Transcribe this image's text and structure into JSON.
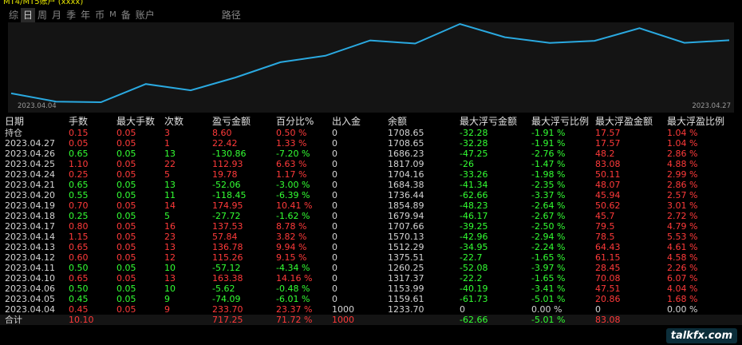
{
  "title_partial": "MT4/MT5账户 (xxxx)",
  "period_tabs": [
    {
      "label": "综",
      "selected": false
    },
    {
      "label": "日",
      "selected": true
    },
    {
      "label": "周",
      "selected": false
    },
    {
      "label": "月",
      "selected": false
    },
    {
      "label": "季",
      "selected": false
    },
    {
      "label": "年",
      "selected": false
    },
    {
      "label": "币",
      "selected": false
    },
    {
      "label": "M",
      "selected": false
    },
    {
      "label": "备",
      "selected": false
    },
    {
      "label": "账户",
      "selected": false
    }
  ],
  "path_label": "路径",
  "chart": {
    "line_color": "#2aa9e0",
    "date_start": "2023.04.04",
    "date_end": "2023.04.27",
    "equity": [
      1233.7,
      1159.61,
      1153.99,
      1317.37,
      1260.25,
      1375.51,
      1512.29,
      1570.13,
      1707.66,
      1679.94,
      1854.89,
      1736.44,
      1684.38,
      1704.16,
      1817.09,
      1686.23,
      1708.65
    ]
  },
  "columns": [
    "日期",
    "手数",
    "最大手数",
    "次数",
    "盈亏金额",
    "百分比%",
    "出入金",
    "余额",
    "最大浮亏金额",
    "最大浮亏比例",
    "最大浮盈金额",
    "最大浮盈比例"
  ],
  "rows": [
    {
      "date": "持仓",
      "lots": "0.15",
      "maxlots": "0.05",
      "count": "3",
      "pl": "8.60",
      "pct": "0.50 %",
      "io": "0",
      "bal": "1708.65",
      "fl": "-32.28",
      "flp": "-1.91 %",
      "fp": "17.57",
      "fpp": "1.04 %",
      "s": "r"
    },
    {
      "date": "2023.04.27",
      "lots": "0.05",
      "maxlots": "0.05",
      "count": "1",
      "pl": "22.42",
      "pct": "1.33 %",
      "io": "0",
      "bal": "1708.65",
      "fl": "-32.28",
      "flp": "-1.91 %",
      "fp": "17.57",
      "fpp": "1.04 %",
      "s": "r"
    },
    {
      "date": "2023.04.26",
      "lots": "0.65",
      "maxlots": "0.05",
      "count": "13",
      "pl": "-130.86",
      "pct": "-7.20 %",
      "io": "0",
      "bal": "1686.23",
      "fl": "-47.25",
      "flp": "-2.76 %",
      "fp": "48.2",
      "fpp": "2.86 %",
      "s": "g"
    },
    {
      "date": "2023.04.25",
      "lots": "1.10",
      "maxlots": "0.05",
      "count": "22",
      "pl": "112.93",
      "pct": "6.63 %",
      "io": "0",
      "bal": "1817.09",
      "fl": "-26",
      "flp": "-1.47 %",
      "fp": "83.08",
      "fpp": "4.88 %",
      "s": "r"
    },
    {
      "date": "2023.04.24",
      "lots": "0.25",
      "maxlots": "0.05",
      "count": "5",
      "pl": "19.78",
      "pct": "1.17 %",
      "io": "0",
      "bal": "1704.16",
      "fl": "-33.26",
      "flp": "-1.98 %",
      "fp": "50.11",
      "fpp": "2.99 %",
      "s": "r"
    },
    {
      "date": "2023.04.21",
      "lots": "0.65",
      "maxlots": "0.05",
      "count": "13",
      "pl": "-52.06",
      "pct": "-3.00 %",
      "io": "0",
      "bal": "1684.38",
      "fl": "-41.34",
      "flp": "-2.35 %",
      "fp": "48.07",
      "fpp": "2.86 %",
      "s": "g"
    },
    {
      "date": "2023.04.20",
      "lots": "0.55",
      "maxlots": "0.05",
      "count": "11",
      "pl": "-118.45",
      "pct": "-6.39 %",
      "io": "0",
      "bal": "1736.44",
      "fl": "-62.66",
      "flp": "-3.37 %",
      "fp": "45.94",
      "fpp": "2.57 %",
      "s": "g"
    },
    {
      "date": "2023.04.19",
      "lots": "0.70",
      "maxlots": "0.05",
      "count": "14",
      "pl": "174.95",
      "pct": "10.41 %",
      "io": "0",
      "bal": "1854.89",
      "fl": "-48.23",
      "flp": "-2.64 %",
      "fp": "50.62",
      "fpp": "3.01 %",
      "s": "r"
    },
    {
      "date": "2023.04.18",
      "lots": "0.25",
      "maxlots": "0.05",
      "count": "5",
      "pl": "-27.72",
      "pct": "-1.62 %",
      "io": "0",
      "bal": "1679.94",
      "fl": "-46.17",
      "flp": "-2.67 %",
      "fp": "45.7",
      "fpp": "2.72 %",
      "s": "g"
    },
    {
      "date": "2023.04.17",
      "lots": "0.80",
      "maxlots": "0.05",
      "count": "16",
      "pl": "137.53",
      "pct": "8.78 %",
      "io": "0",
      "bal": "1707.66",
      "fl": "-39.25",
      "flp": "-2.50 %",
      "fp": "79.5",
      "fpp": "4.79 %",
      "s": "r"
    },
    {
      "date": "2023.04.14",
      "lots": "1.15",
      "maxlots": "0.05",
      "count": "23",
      "pl": "57.84",
      "pct": "3.82 %",
      "io": "0",
      "bal": "1570.13",
      "fl": "-42.96",
      "flp": "-2.94 %",
      "fp": "78.5",
      "fpp": "5.53 %",
      "s": "r"
    },
    {
      "date": "2023.04.13",
      "lots": "0.65",
      "maxlots": "0.05",
      "count": "13",
      "pl": "136.78",
      "pct": "9.94 %",
      "io": "0",
      "bal": "1512.29",
      "fl": "-34.95",
      "flp": "-2.24 %",
      "fp": "64.43",
      "fpp": "4.61 %",
      "s": "r"
    },
    {
      "date": "2023.04.12",
      "lots": "0.60",
      "maxlots": "0.05",
      "count": "12",
      "pl": "115.26",
      "pct": "9.15 %",
      "io": "0",
      "bal": "1375.51",
      "fl": "-22.7",
      "flp": "-1.65 %",
      "fp": "61.15",
      "fpp": "4.58 %",
      "s": "r"
    },
    {
      "date": "2023.04.11",
      "lots": "0.50",
      "maxlots": "0.05",
      "count": "10",
      "pl": "-57.12",
      "pct": "-4.34 %",
      "io": "0",
      "bal": "1260.25",
      "fl": "-52.08",
      "flp": "-3.97 %",
      "fp": "28.45",
      "fpp": "2.26 %",
      "s": "g"
    },
    {
      "date": "2023.04.10",
      "lots": "0.65",
      "maxlots": "0.05",
      "count": "13",
      "pl": "163.38",
      "pct": "14.16 %",
      "io": "0",
      "bal": "1317.37",
      "fl": "-22.2",
      "flp": "-1.65 %",
      "fp": "70.08",
      "fpp": "6.07 %",
      "s": "r"
    },
    {
      "date": "2023.04.06",
      "lots": "0.50",
      "maxlots": "0.05",
      "count": "10",
      "pl": "-5.62",
      "pct": "-0.48 %",
      "io": "0",
      "bal": "1153.99",
      "fl": "-40.19",
      "flp": "-3.41 %",
      "fp": "47.51",
      "fpp": "4.04 %",
      "s": "g"
    },
    {
      "date": "2023.04.05",
      "lots": "0.45",
      "maxlots": "0.05",
      "count": "9",
      "pl": "-74.09",
      "pct": "-6.01 %",
      "io": "0",
      "bal": "1159.61",
      "fl": "-61.73",
      "flp": "-5.01 %",
      "fp": "20.86",
      "fpp": "1.68 %",
      "s": "g"
    },
    {
      "date": "2023.04.04",
      "lots": "0.45",
      "maxlots": "0.05",
      "count": "9",
      "pl": "233.70",
      "pct": "23.37 %",
      "io": "1000",
      "bal": "1233.70",
      "fl": "0",
      "flp": "0.00 %",
      "fp": "0",
      "fpp": "0.00 %",
      "s": "r"
    }
  ],
  "total": {
    "date": "合计",
    "lots": "10.10",
    "pl": "717.25",
    "pct": "71.72 %",
    "io": "1000",
    "fl": "-62.66",
    "flp": "-5.01 %",
    "fp": "83.08"
  },
  "watermark": "talkfx.com"
}
